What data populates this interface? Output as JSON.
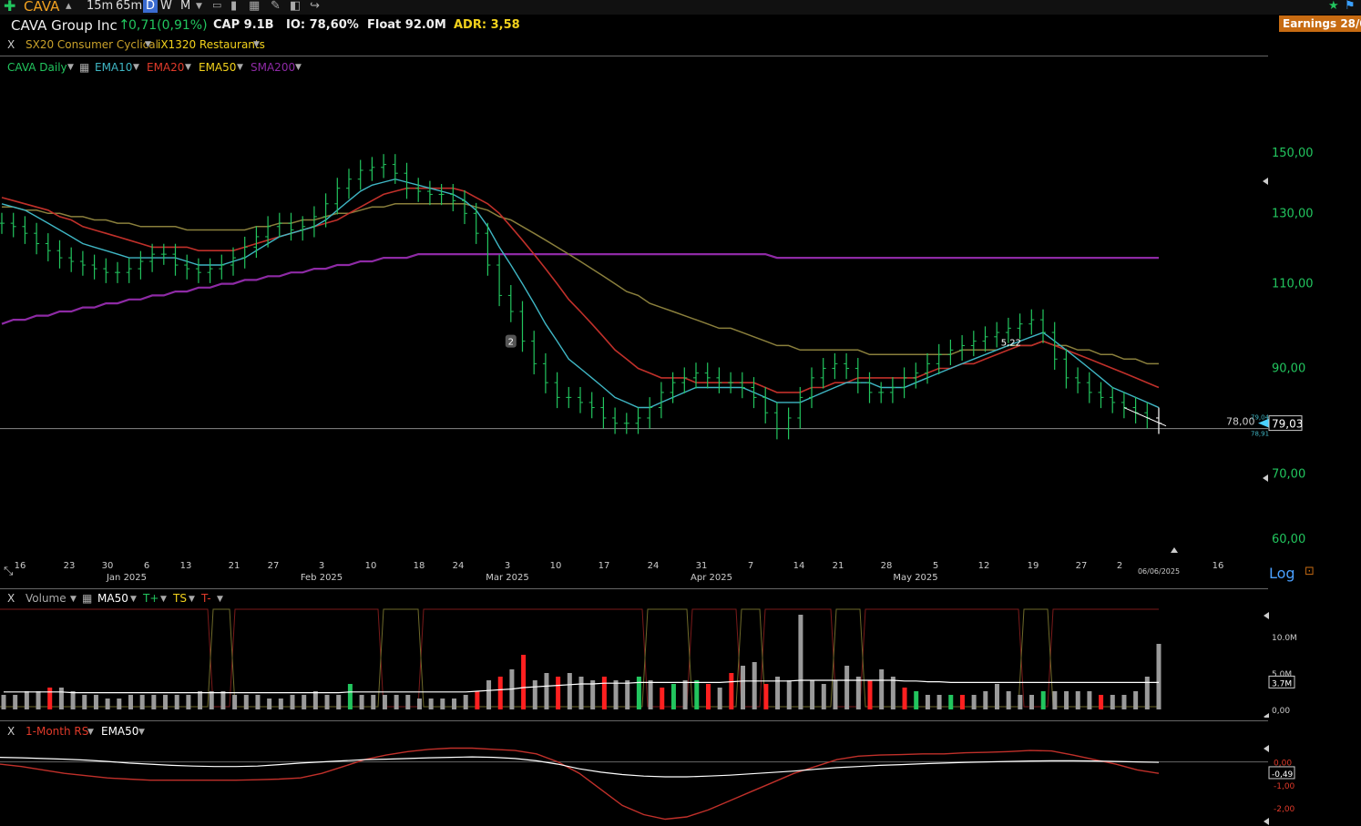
{
  "toolbar": {
    "ticker": "CAVA",
    "intervals": [
      "15m",
      "65m",
      "D",
      "W",
      "M"
    ],
    "active_interval": "D"
  },
  "info": {
    "company": "CAVA Group Inc",
    "change": "0,71(0,91%)",
    "cap": "CAP 9.1B",
    "io": "IO: 78,60%",
    "float": "Float 92.0M",
    "adr": "ADR: 3,58",
    "earnings": "Earnings 28/0"
  },
  "sector": {
    "close": "X",
    "sector": "SX20 Consumer Cyclical",
    "industry": "iX1320 Restaurants"
  },
  "legend": {
    "series": "CAVA Daily",
    "ema10": "EMA10",
    "ema20": "EMA20",
    "ema50": "EMA50",
    "sma200": "SMA200"
  },
  "colors": {
    "up": "#22c55e",
    "down": "#ff2020",
    "ema10": "#3fb6c4",
    "ema20": "#c0302a",
    "ema50": "#8a7f3c",
    "sma200": "#8e2aa5",
    "accent": "#c76b12"
  },
  "chart_data": {
    "type": "line",
    "scale": "log",
    "price_axis": [
      "150,00",
      "130,00",
      "110,00",
      "90,00",
      "70,00",
      "60,00"
    ],
    "price_values": [
      150,
      130,
      110,
      90,
      70,
      60
    ],
    "ylim": [
      56,
      165
    ],
    "last_price_label": "79,03",
    "last_price": 79.03,
    "hline_label": "78,00",
    "hline_value": 78.0,
    "mini_high": "79,04",
    "mini_low": "78,91",
    "annotation_2": "2",
    "annotation_522": "5,22",
    "date_ticks": [
      "16",
      "23",
      "30",
      "6",
      "13",
      "21",
      "27",
      "3",
      "10",
      "18",
      "24",
      "3",
      "10",
      "17",
      "24",
      "31",
      "7",
      "14",
      "21",
      "28",
      "5",
      "12",
      "19",
      "27",
      "2",
      "06/06/2025",
      "16"
    ],
    "month_labels": [
      "Jan 2025",
      "Feb 2025",
      "Mar 2025",
      "Apr 2025",
      "May 2025"
    ],
    "log_label": "Log",
    "closes": [
      127,
      126,
      124,
      121,
      119,
      117,
      116,
      115,
      114,
      113,
      113,
      114,
      116,
      118,
      118,
      115,
      114,
      113,
      114,
      115,
      117,
      120,
      123,
      126,
      127,
      125,
      126,
      129,
      133,
      138,
      141,
      144,
      145,
      146,
      143,
      138,
      137,
      136,
      136,
      134,
      130,
      124,
      115,
      107,
      103,
      96,
      91,
      87,
      84,
      84,
      83,
      82,
      80,
      79,
      79,
      80,
      82,
      85,
      87,
      88,
      89,
      88,
      87,
      87,
      86,
      84,
      81,
      78,
      80,
      84,
      88,
      90,
      91,
      90,
      87,
      85,
      85,
      86,
      88,
      89,
      91,
      93,
      94,
      95,
      96,
      97,
      98,
      99,
      100,
      101,
      98,
      92,
      88,
      87,
      85,
      84,
      83,
      82,
      81,
      80,
      79
    ],
    "ema10": [
      133,
      132,
      131,
      129,
      127,
      125,
      123,
      121,
      120,
      119,
      118,
      117,
      117,
      117,
      117,
      117,
      116,
      115,
      115,
      115,
      116,
      117,
      119,
      121,
      123,
      124,
      125,
      126,
      128,
      131,
      134,
      137,
      139,
      140,
      141,
      140,
      139,
      138,
      137,
      136,
      134,
      131,
      126,
      120,
      115,
      110,
      105,
      100,
      96,
      92,
      90,
      88,
      86,
      84,
      83,
      82,
      82,
      83,
      84,
      85,
      86,
      86,
      86,
      86,
      86,
      85,
      84,
      83,
      83,
      83,
      84,
      85,
      86,
      87,
      87,
      87,
      86,
      86,
      86,
      87,
      88,
      89,
      90,
      91,
      92,
      93,
      94,
      95,
      96,
      97,
      98,
      96,
      94,
      92,
      90,
      88,
      86,
      85,
      84,
      83,
      82
    ],
    "ema20": [
      135,
      134,
      133,
      132,
      131,
      129,
      128,
      126,
      125,
      124,
      123,
      122,
      121,
      120,
      120,
      120,
      120,
      119,
      119,
      119,
      119,
      120,
      121,
      122,
      123,
      124,
      125,
      126,
      127,
      128,
      130,
      132,
      134,
      136,
      137,
      138,
      138,
      138,
      138,
      138,
      137,
      135,
      133,
      130,
      126,
      122,
      118,
      114,
      110,
      106,
      103,
      100,
      97,
      94,
      92,
      90,
      89,
      88,
      88,
      88,
      87,
      87,
      87,
      87,
      87,
      87,
      86,
      85,
      85,
      85,
      86,
      86,
      87,
      87,
      88,
      88,
      88,
      88,
      88,
      88,
      89,
      90,
      90,
      91,
      91,
      92,
      93,
      94,
      95,
      95,
      96,
      95,
      94,
      93,
      92,
      91,
      90,
      89,
      88,
      87,
      86
    ],
    "ema50": [
      132,
      132,
      131,
      131,
      130,
      130,
      129,
      129,
      128,
      128,
      127,
      127,
      126,
      126,
      126,
      126,
      125,
      125,
      125,
      125,
      125,
      125,
      126,
      126,
      127,
      127,
      128,
      128,
      129,
      130,
      130,
      131,
      132,
      132,
      133,
      133,
      133,
      133,
      133,
      133,
      133,
      132,
      131,
      129,
      128,
      126,
      124,
      122,
      120,
      118,
      116,
      114,
      112,
      110,
      108,
      107,
      105,
      104,
      103,
      102,
      101,
      100,
      99,
      99,
      98,
      97,
      96,
      95,
      95,
      94,
      94,
      94,
      94,
      94,
      94,
      93,
      93,
      93,
      93,
      93,
      93,
      93,
      93,
      94,
      94,
      94,
      94,
      95,
      95,
      95,
      96,
      95,
      95,
      94,
      94,
      93,
      93,
      92,
      92,
      91,
      91
    ],
    "sma200": [
      100,
      101,
      101,
      102,
      102,
      103,
      103,
      104,
      104,
      105,
      105,
      106,
      106,
      107,
      107,
      108,
      108,
      109,
      109,
      110,
      110,
      111,
      111,
      112,
      112,
      113,
      113,
      114,
      114,
      115,
      115,
      116,
      116,
      117,
      117,
      117,
      118,
      118,
      118,
      118,
      118,
      118,
      118,
      118,
      118,
      118,
      118,
      118,
      118,
      118,
      118,
      118,
      118,
      118,
      118,
      118,
      118,
      118,
      118,
      118,
      118,
      118,
      118,
      118,
      118,
      118,
      118,
      117,
      117,
      117,
      117,
      117,
      117,
      117,
      117,
      117,
      117,
      117,
      117,
      117,
      117,
      117,
      117,
      117,
      117,
      117,
      117,
      117,
      117,
      117,
      117,
      117,
      117,
      117,
      117,
      117,
      117,
      117,
      117,
      117,
      117
    ]
  },
  "volume": {
    "close": "X",
    "title": "Volume",
    "ma": "MA50",
    "tplus": "T+",
    "ts": "TS",
    "tminus": "T-",
    "axis": [
      "10.0M",
      "5.0M",
      "0,00"
    ],
    "last_label": "3.7M",
    "ylim_m": [
      0,
      14
    ],
    "values_m": [
      2.0,
      2.0,
      2.5,
      2.5,
      3.0,
      3.0,
      2.5,
      2.0,
      2.0,
      1.5,
      1.5,
      2.0,
      2.0,
      2.0,
      2.0,
      2.0,
      2.0,
      2.5,
      2.5,
      2.5,
      2.0,
      2.0,
      2.0,
      1.5,
      1.5,
      2.0,
      2.0,
      2.5,
      2.0,
      2.0,
      3.5,
      2.0,
      2.0,
      2.0,
      2.0,
      2.0,
      1.5,
      1.5,
      1.5,
      1.5,
      2.0,
      2.5,
      4.0,
      4.5,
      5.5,
      7.5,
      4.0,
      5.0,
      4.5,
      5.0,
      4.5,
      4.0,
      4.5,
      4.0,
      4.0,
      4.5,
      4.0,
      3.0,
      3.5,
      4.0,
      4.0,
      3.5,
      3.0,
      5.0,
      6.0,
      6.5,
      3.5,
      4.5,
      4.0,
      13.0,
      4.0,
      3.5,
      4.0,
      6.0,
      4.5,
      4.0,
      5.5,
      4.5,
      3.0,
      2.5,
      2.0,
      2.0,
      2.0,
      2.0,
      2.0,
      2.5,
      3.5,
      2.5,
      2.0,
      2.0,
      2.5,
      2.5,
      2.5,
      2.5,
      2.5,
      2.0,
      2.0,
      2.0,
      2.5,
      4.5,
      9.0
    ],
    "colors_idx": {
      "green": [
        30,
        55,
        58,
        60,
        79,
        82,
        90
      ],
      "red": [
        4,
        41,
        43,
        45,
        48,
        52,
        57,
        61,
        63,
        66,
        75,
        78,
        83,
        95
      ]
    },
    "ma50_m": [
      2.4,
      2.4,
      2.4,
      2.4,
      2.4,
      2.4,
      2.3,
      2.3,
      2.3,
      2.3,
      2.3,
      2.3,
      2.3,
      2.3,
      2.3,
      2.3,
      2.3,
      2.3,
      2.3,
      2.3,
      2.3,
      2.3,
      2.3,
      2.3,
      2.3,
      2.3,
      2.3,
      2.3,
      2.3,
      2.3,
      2.4,
      2.4,
      2.4,
      2.4,
      2.4,
      2.4,
      2.4,
      2.4,
      2.4,
      2.4,
      2.4,
      2.5,
      2.6,
      2.7,
      2.8,
      3.0,
      3.1,
      3.2,
      3.3,
      3.4,
      3.5,
      3.5,
      3.6,
      3.6,
      3.6,
      3.7,
      3.7,
      3.7,
      3.7,
      3.7,
      3.7,
      3.7,
      3.7,
      3.8,
      3.9,
      3.9,
      3.9,
      3.9,
      3.9,
      4.0,
      4.0,
      4.0,
      4.0,
      4.0,
      4.0,
      4.0,
      4.0,
      4.0,
      3.9,
      3.9,
      3.8,
      3.8,
      3.7,
      3.7,
      3.7,
      3.7,
      3.7,
      3.7,
      3.7,
      3.7,
      3.7,
      3.7,
      3.7,
      3.7,
      3.7,
      3.7,
      3.7,
      3.7,
      3.7,
      3.7,
      3.7
    ]
  },
  "rs": {
    "close": "X",
    "title": "1-Month RS",
    "ema": "EMA50",
    "axis": [
      "0,00",
      "-1,00",
      "-2,00"
    ],
    "axis_values": [
      0,
      -1,
      -2
    ],
    "last_label": "-0,49",
    "ylim": [
      -2.6,
      0.9
    ],
    "rs_values": [
      -0.1,
      -0.2,
      -0.35,
      -0.5,
      -0.6,
      -0.7,
      -0.75,
      -0.8,
      -0.8,
      -0.8,
      -0.8,
      -0.8,
      -0.78,
      -0.75,
      -0.7,
      -0.5,
      -0.2,
      0.1,
      0.3,
      0.45,
      0.55,
      0.6,
      0.6,
      0.55,
      0.5,
      0.35,
      0.0,
      -0.5,
      -1.2,
      -1.9,
      -2.3,
      -2.5,
      -2.4,
      -2.1,
      -1.7,
      -1.3,
      -0.9,
      -0.5,
      -0.2,
      0.1,
      0.25,
      0.3,
      0.32,
      0.35,
      0.35,
      0.4,
      0.42,
      0.45,
      0.5,
      0.48,
      0.3,
      0.1,
      -0.1,
      -0.35,
      -0.5
    ],
    "ema_values": [
      0.2,
      0.18,
      0.15,
      0.12,
      0.08,
      0.02,
      -0.05,
      -0.1,
      -0.15,
      -0.18,
      -0.2,
      -0.2,
      -0.18,
      -0.12,
      -0.05,
      0.0,
      0.05,
      0.1,
      0.12,
      0.15,
      0.18,
      0.2,
      0.22,
      0.2,
      0.15,
      0.05,
      -0.1,
      -0.3,
      -0.45,
      -0.55,
      -0.62,
      -0.65,
      -0.65,
      -0.62,
      -0.58,
      -0.52,
      -0.46,
      -0.4,
      -0.32,
      -0.25,
      -0.2,
      -0.15,
      -0.12,
      -0.08,
      -0.05,
      -0.02,
      0.0,
      0.02,
      0.04,
      0.05,
      0.05,
      0.04,
      0.02,
      0.0,
      -0.02
    ]
  }
}
